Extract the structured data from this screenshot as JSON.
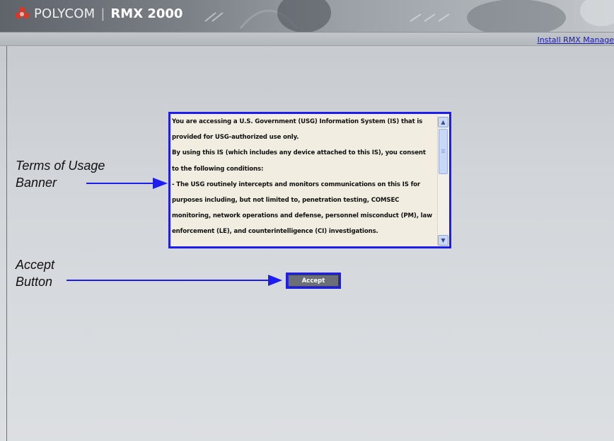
{
  "header": {
    "brand": "POLYCOM",
    "separator": "|",
    "product": "RMX 2000",
    "install_link": "Install RMX Manage"
  },
  "banner": {
    "lines": [
      "You are accessing a U.S. Government (USG) Information System (IS) that is",
      "provided for USG-authorized use only.",
      "By using this IS (which includes any device attached to this IS), you consent",
      "to the following conditions:",
      "- The USG routinely intercepts and monitors communications on this IS for",
      "purposes including, but not limited to, penetration testing, COMSEC",
      "monitoring, network operations and defense, personnel misconduct (PM), law",
      "enforcement (LE), and counterintelligence (CI) investigations."
    ]
  },
  "accept": {
    "label": "Accept"
  },
  "annotations": {
    "banner_label_line1": "Terms of Usage",
    "banner_label_line2": "Banner",
    "accept_label_line1": "Accept",
    "accept_label_line2": "Button"
  },
  "icons": [
    "polycom-logo-icon",
    "scroll-up-icon",
    "scroll-down-icon"
  ],
  "colors": {
    "highlight_blue": "#1d1df0",
    "logo_red": "#d23a2a",
    "link_blue": "#1a1ab8"
  }
}
